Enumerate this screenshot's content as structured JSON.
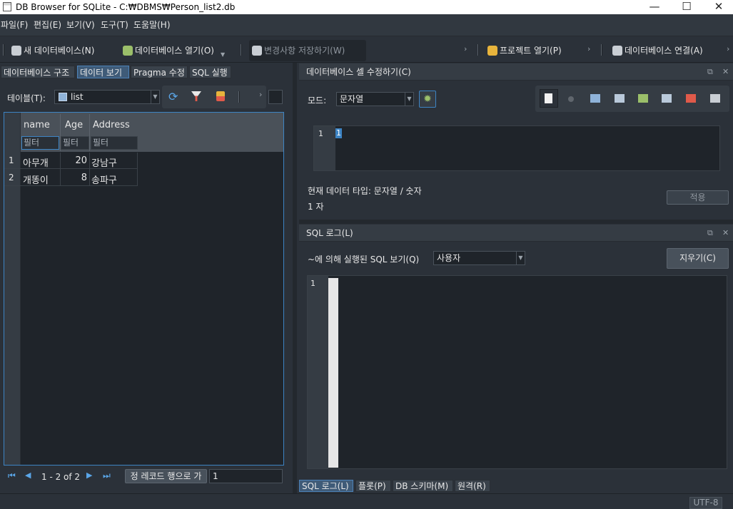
{
  "window": {
    "title": "DB Browser for SQLite - C:₩DBMS₩Person_list2.db",
    "minimize": "—",
    "maximize": "☐",
    "close": "✕"
  },
  "menu": [
    {
      "label": "파일(F)"
    },
    {
      "label": "편집(E)"
    },
    {
      "label": "보기(V)"
    },
    {
      "label": "도구(T)"
    },
    {
      "label": "도움말(H)"
    }
  ],
  "toolbar": {
    "new_db": "새 데이터베이스(N)",
    "open_db": "데이터베이스 열기(O)",
    "write_changes": "변경사항 저장하기(W)",
    "open_project": "프로젝트 열기(P)",
    "attach_db": "데이터베이스 연결(A)",
    "chevron": "›"
  },
  "tabs": [
    {
      "label": "데이터베이스 구조"
    },
    {
      "label": "데이터 보기"
    },
    {
      "label": "Pragma 수정"
    },
    {
      "label": "SQL 실행"
    }
  ],
  "browse": {
    "table_label": "테이블(T):",
    "table_value": "list",
    "columns": [
      "name",
      "Age",
      "Address"
    ],
    "filter_placeholder": "필터",
    "rows": [
      {
        "num": "1",
        "name": "아무개",
        "age": "20",
        "address": "강남구"
      },
      {
        "num": "2",
        "name": "개똥이",
        "age": "8",
        "address": "송파구"
      }
    ],
    "pager": "1 - 2 of 2",
    "goto_label": "정 레코드 행으로 가",
    "goto_value": "1"
  },
  "edit_cell": {
    "title": "데이터베이스 셀 수정하기(C)",
    "mode_label": "모드:",
    "mode_value": "문자열",
    "line_no": "1",
    "content": "1",
    "type_info": "현재 데이터 타입: 문자열 / 숫자",
    "size_info": "1 자",
    "apply": "적용"
  },
  "sql_log": {
    "title": "SQL 로그(L)",
    "submitted_label": "~에 의해 실행된 SQL 보기(Q)",
    "submitted_value": "사용자",
    "clear": "지우기(C)",
    "line_no": "1"
  },
  "bottom_tabs": [
    {
      "label": "SQL 로그(L)"
    },
    {
      "label": "플롯(P)"
    },
    {
      "label": "DB 스키마(M)"
    },
    {
      "label": "원격(R)"
    }
  ],
  "status": {
    "encoding": "UTF-8"
  },
  "colors": {
    "accent": "#3d84c4",
    "background": "#2b3139"
  }
}
